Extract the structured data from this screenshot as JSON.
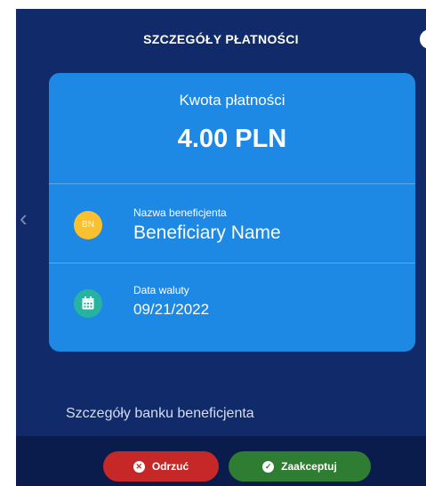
{
  "header": {
    "title": "SZCZEGÓŁY PŁATNOŚCI",
    "close_icon": "close-icon"
  },
  "card": {
    "amount_label": "Kwota płatności",
    "amount_value": "4.00 PLN",
    "beneficiary": {
      "initials": "BN",
      "label": "Nazwa beneficjenta",
      "value": "Beneficiary Name"
    },
    "value_date": {
      "label": "Data waluty",
      "value": "09/21/2022"
    }
  },
  "bank_details_link": "Szczegóły banku beneficjenta",
  "footer": {
    "reject_label": "Odrzuć",
    "accept_label": "Zaakceptuj"
  },
  "colors": {
    "panel": "#102a6a",
    "card": "#1e88e5",
    "footer": "#0a1c4c",
    "reject": "#c62828",
    "accept": "#2e7d32",
    "avatar": "#fbc02d",
    "calendar": "#26b4a0"
  }
}
